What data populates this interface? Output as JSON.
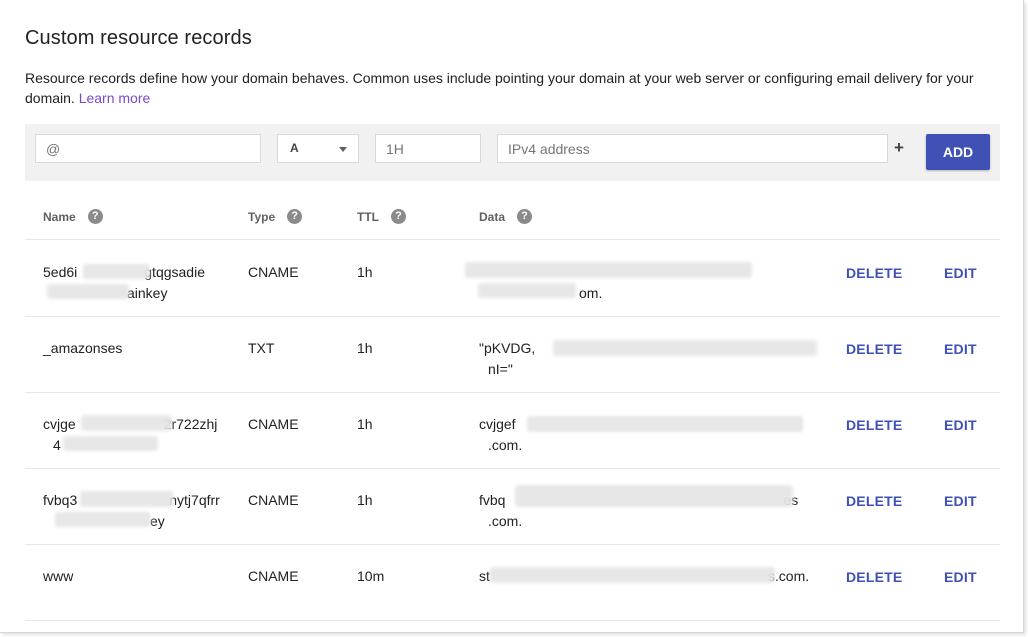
{
  "section": {
    "title": "Custom resource records",
    "description": "Resource records define how your domain behaves. Common uses include pointing your domain at your web server or configuring email delivery for your domain.",
    "learn_more": "Learn more"
  },
  "add_form": {
    "name_placeholder": "@",
    "type_value": "A",
    "ttl_placeholder": "1H",
    "data_placeholder": "IPv4 address",
    "plus": "+",
    "add_label": "ADD"
  },
  "table": {
    "headers": {
      "name": "Name",
      "type": "Type",
      "ttl": "TTL",
      "data": "Data"
    },
    "help_glyph": "?",
    "delete_label": "DELETE",
    "edit_label": "EDIT",
    "rows": [
      {
        "name_line1": "5ed6i",
        "name_line1b": "gtqgsadie",
        "name_line2": "ainkey",
        "type": "CNAME",
        "ttl": "1h",
        "data_line1": "",
        "data_line2": "om."
      },
      {
        "name_line1": "_amazonses",
        "name_line1b": "",
        "name_line2": "",
        "type": "TXT",
        "ttl": "1h",
        "data_line1": "\"pKVDG,",
        "data_line2": "nI=\""
      },
      {
        "name_line1": "cvjge",
        "name_line1b": "2r722zhj",
        "name_line2": "4",
        "type": "CNAME",
        "ttl": "1h",
        "data_line1": "cvjgef",
        "data_line2": ".com."
      },
      {
        "name_line1": "fvbq3",
        "name_line1b": "nytj7qfrr",
        "name_line2": "ey",
        "type": "CNAME",
        "ttl": "1h",
        "data_line1": "fvbq",
        "data_line1b": "es",
        "data_line2": ".com."
      },
      {
        "name_line1": "www",
        "name_line1b": "",
        "name_line2": "",
        "type": "CNAME",
        "ttl": "10m",
        "data_line1": "st",
        "data_line1b": "s.com.",
        "data_line2": ""
      }
    ]
  },
  "colors": {
    "accent": "#3f51b5",
    "link": "#7b48c6",
    "bar_bg": "#f1f1f1"
  }
}
